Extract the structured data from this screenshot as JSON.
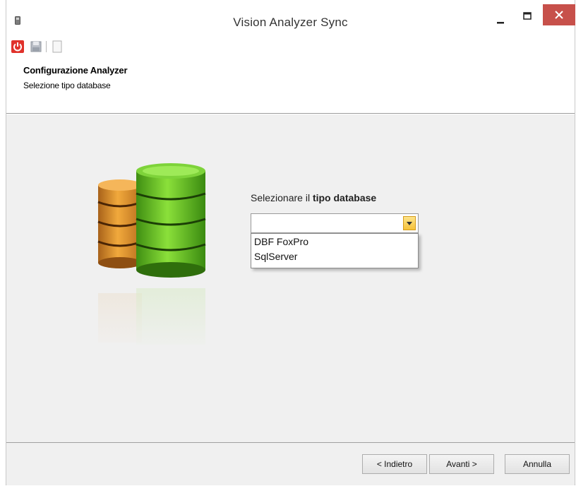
{
  "window": {
    "title": "Vision Analyzer Sync",
    "icon": "app-icon"
  },
  "title_buttons": {
    "minimize_icon": "minimize-icon",
    "maximize_icon": "maximize-icon",
    "close_icon": "close-icon",
    "close_color": "#c7504a"
  },
  "toolbar": {
    "items": [
      {
        "icon": "power-icon",
        "color": "#e0322b"
      },
      {
        "icon": "save-icon"
      },
      {
        "icon": "document-icon"
      }
    ]
  },
  "header": {
    "title": "Configurazione Analyzer",
    "subtitle": "Selezione tipo database"
  },
  "main": {
    "illustration": "database-icon",
    "select_label_prefix": "Selezionare  il ",
    "select_label_bold": "tipo database",
    "combo": {
      "value": "",
      "options": [
        "DBF FoxPro",
        "SqlServer"
      ]
    }
  },
  "footer": {
    "back_label": "< Indietro",
    "next_label": "Avanti >",
    "cancel_label": "Annulla"
  }
}
